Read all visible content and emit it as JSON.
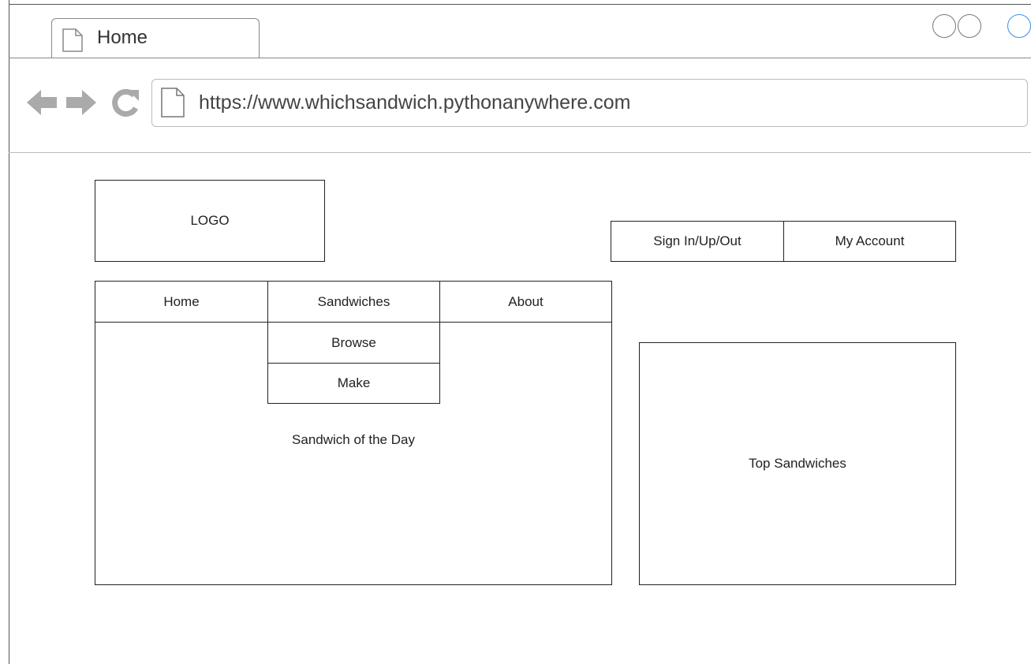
{
  "browser": {
    "tab_title": "Home",
    "url": "https://www.whichsandwich.pythonanywhere.com"
  },
  "page": {
    "logo": "LOGO",
    "account_nav": {
      "sign_in": "Sign In/Up/Out",
      "my_account": "My Account"
    },
    "main_nav": {
      "home": "Home",
      "sandwiches": "Sandwiches",
      "about": "About"
    },
    "sandwiches_dropdown": {
      "browse": "Browse",
      "make": "Make"
    },
    "panels": {
      "sandwich_of_day": "Sandwich of the Day",
      "top_sandwiches": "Top Sandwiches"
    }
  }
}
